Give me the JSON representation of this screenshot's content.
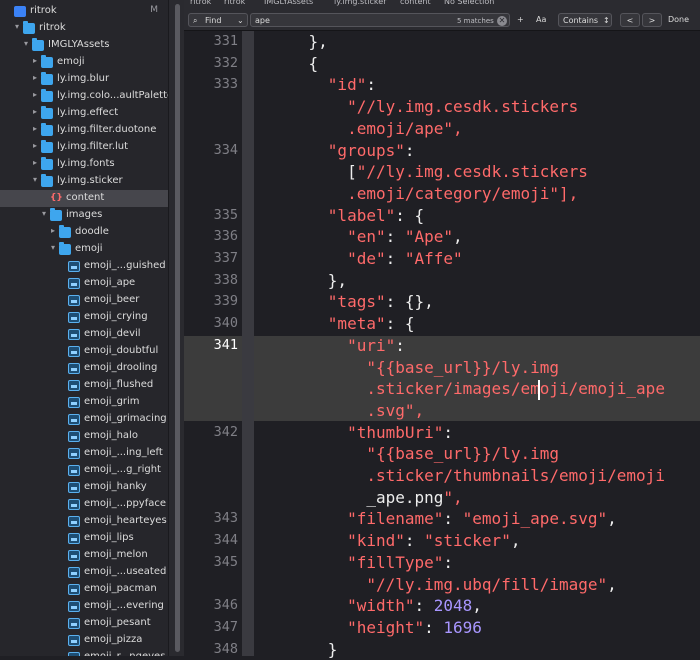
{
  "sidebar": {
    "rows": [
      {
        "label": "ritrok",
        "type": "project",
        "chev": "",
        "badge": "M"
      },
      {
        "label": "ritrok",
        "type": "folder",
        "chev": "open"
      },
      {
        "label": "IMGLYAssets",
        "type": "folder",
        "chev": "open"
      },
      {
        "label": "emoji",
        "type": "folder",
        "chev": "closed"
      },
      {
        "label": "ly.img.blur",
        "type": "folder",
        "chev": "closed"
      },
      {
        "label": "ly.img.colo...aultPalette",
        "type": "folder",
        "chev": "closed"
      },
      {
        "label": "ly.img.effect",
        "type": "folder",
        "chev": "closed"
      },
      {
        "label": "ly.img.filter.duotone",
        "type": "folder",
        "chev": "closed"
      },
      {
        "label": "ly.img.filter.lut",
        "type": "folder",
        "chev": "closed"
      },
      {
        "label": "ly.img.fonts",
        "type": "folder",
        "chev": "closed"
      },
      {
        "label": "ly.img.sticker",
        "type": "folder",
        "chev": "open"
      },
      {
        "label": "content",
        "type": "json",
        "chev": "",
        "selected": true
      },
      {
        "label": "images",
        "type": "folder",
        "chev": "open"
      },
      {
        "label": "doodle",
        "type": "folder",
        "chev": "closed"
      },
      {
        "label": "emoji",
        "type": "folder",
        "chev": "open"
      },
      {
        "label": "emoji_...guished",
        "type": "image"
      },
      {
        "label": "emoji_ape",
        "type": "image"
      },
      {
        "label": "emoji_beer",
        "type": "image"
      },
      {
        "label": "emoji_crying",
        "type": "image"
      },
      {
        "label": "emoji_devil",
        "type": "image"
      },
      {
        "label": "emoji_doubtful",
        "type": "image"
      },
      {
        "label": "emoji_drooling",
        "type": "image"
      },
      {
        "label": "emoji_flushed",
        "type": "image"
      },
      {
        "label": "emoji_grim",
        "type": "image"
      },
      {
        "label": "emoji_grimacing",
        "type": "image"
      },
      {
        "label": "emoji_halo",
        "type": "image"
      },
      {
        "label": "emoji_...ing_left",
        "type": "image"
      },
      {
        "label": "emoji_...g_right",
        "type": "image"
      },
      {
        "label": "emoji_hanky",
        "type": "image"
      },
      {
        "label": "emoji_...ppyface",
        "type": "image"
      },
      {
        "label": "emoji_hearteyes",
        "type": "image"
      },
      {
        "label": "emoji_lips",
        "type": "image"
      },
      {
        "label": "emoji_melon",
        "type": "image"
      },
      {
        "label": "emoji_...useated",
        "type": "image"
      },
      {
        "label": "emoji_pacman",
        "type": "image"
      },
      {
        "label": "emoji_...evering",
        "type": "image"
      },
      {
        "label": "emoji_pesant",
        "type": "image"
      },
      {
        "label": "emoji_pizza",
        "type": "image"
      },
      {
        "label": "emoji_r...ngeyes",
        "type": "image"
      }
    ]
  },
  "breadcrumb": [
    "ritrok",
    "ritrok",
    "IMGLYAssets",
    "ly.img.sticker",
    "content",
    "No Selection"
  ],
  "findbar": {
    "mode": "Find",
    "query": "ape",
    "matches": "5 matches",
    "plus": "+",
    "case_label": "Aa",
    "match_type": "Contains",
    "prev": "<",
    "next": ">",
    "done": "Done"
  },
  "editor": {
    "current_line": "341",
    "lines": [
      {
        "num": "331",
        "text": "    },"
      },
      {
        "num": "332",
        "text": "    {"
      },
      {
        "num": "333",
        "text": "      \"id\":"
      },
      {
        "num": "",
        "text": "        \"//ly.img.cesdk.stickers"
      },
      {
        "num": "",
        "text": "        .emoji/ape\","
      },
      {
        "num": "334",
        "text": "      \"groups\":"
      },
      {
        "num": "",
        "text": "        [\"//ly.img.cesdk.stickers"
      },
      {
        "num": "",
        "text": "        .emoji/category/emoji\"],"
      },
      {
        "num": "335",
        "text": "      \"label\": {"
      },
      {
        "num": "336",
        "text": "        \"en\": \"Ape\","
      },
      {
        "num": "337",
        "text": "        \"de\": \"Affe\""
      },
      {
        "num": "338",
        "text": "      },"
      },
      {
        "num": "339",
        "text": "      \"tags\": {},"
      },
      {
        "num": "340",
        "text": "      \"meta\": {"
      },
      {
        "num": "341",
        "text": "        \"uri\":"
      },
      {
        "num": "",
        "text": "          \"{{base_url}}/ly.img"
      },
      {
        "num": "",
        "text": "          .sticker/images/emoji/emoji_ape"
      },
      {
        "num": "",
        "text": "          .svg\","
      },
      {
        "num": "342",
        "text": "        \"thumbUri\":"
      },
      {
        "num": "",
        "text": "          \"{{base_url}}/ly.img"
      },
      {
        "num": "",
        "text": "          .sticker/thumbnails/emoji/emoji"
      },
      {
        "num": "",
        "text": "          _ape.png\","
      },
      {
        "num": "343",
        "text": "        \"filename\": \"emoji_ape.svg\","
      },
      {
        "num": "344",
        "text": "        \"kind\": \"sticker\","
      },
      {
        "num": "345",
        "text": "        \"fillType\":"
      },
      {
        "num": "",
        "text": "          \"//ly.img.ubq/fill/image\","
      },
      {
        "num": "346",
        "text": "        \"width\": 2048,"
      },
      {
        "num": "347",
        "text": "        \"height\": 1696"
      },
      {
        "num": "348",
        "text": "      }"
      }
    ]
  },
  "colors": {
    "string": "#ff6a6a",
    "number": "#a896ff",
    "folder": "#3ea6ee"
  }
}
